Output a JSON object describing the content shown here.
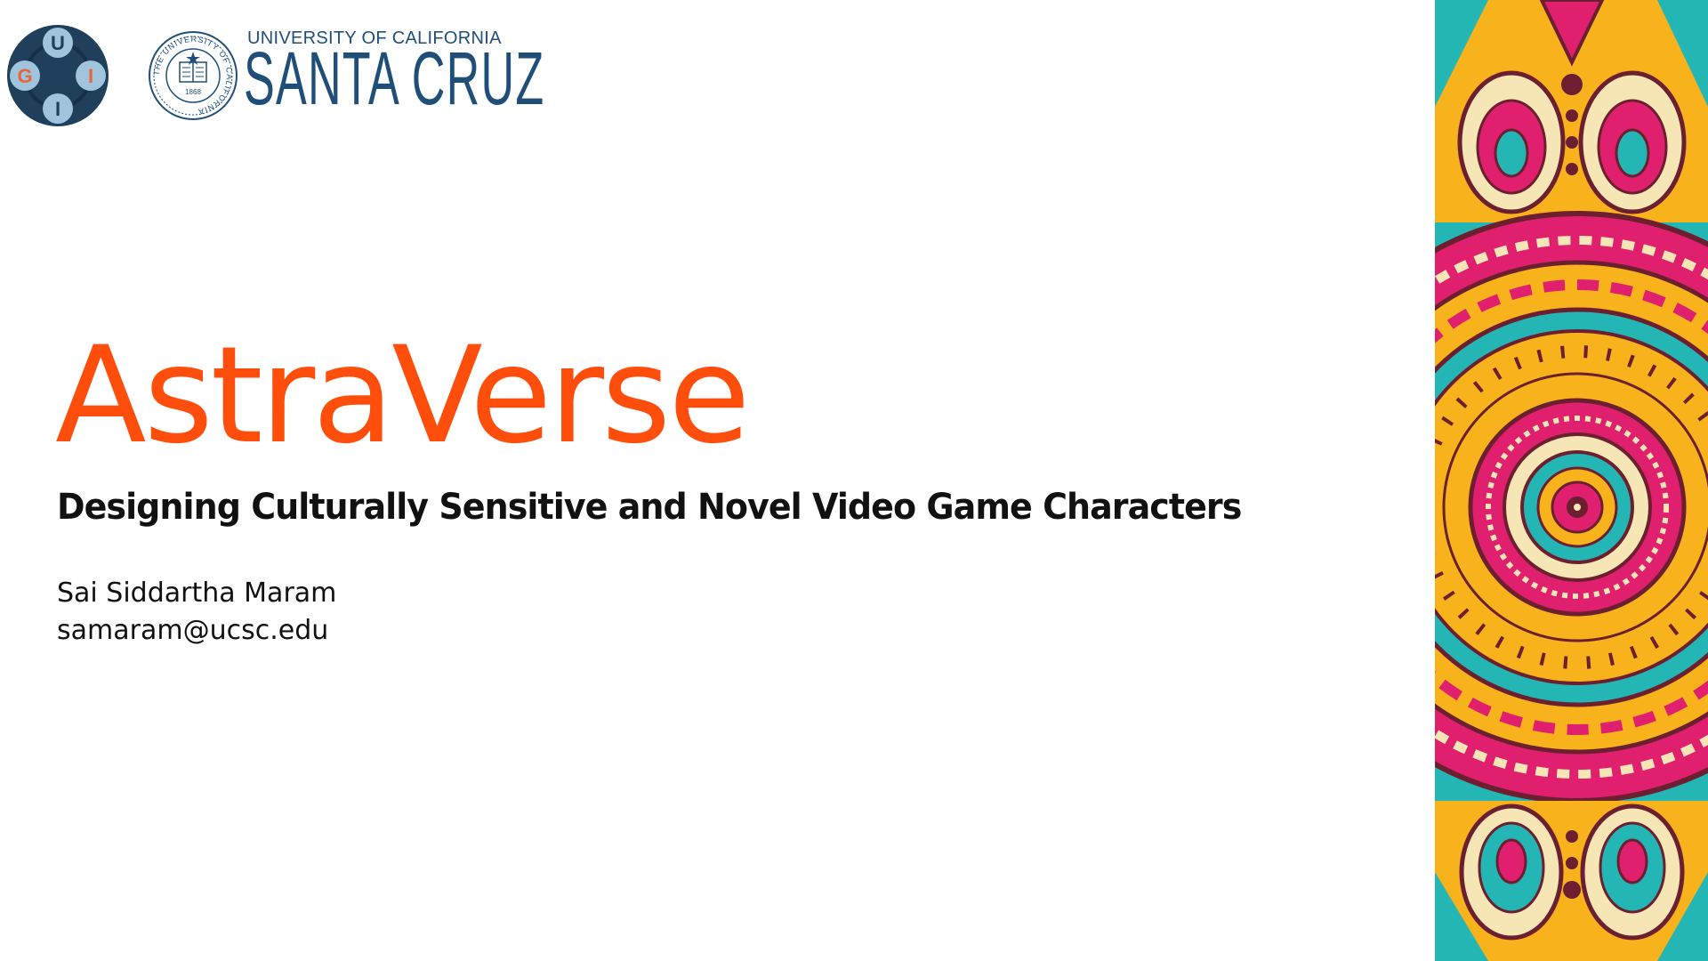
{
  "slide": {
    "title": "AstraVerse",
    "subtitle": "Designing Culturally Sensitive and Novel Video Game Characters",
    "author": "Sai Siddartha Maram",
    "email": "samaram@ucsc.edu"
  },
  "logos": {
    "gii": {
      "letters": [
        "U",
        "G",
        "I",
        "I"
      ]
    },
    "ucsc": {
      "line1": "UNIVERSITY OF CALIFORNIA",
      "line2": "SANTA CRUZ",
      "seal_text": "THE UNIVERSITY OF CALIFORNIA",
      "seal_year": "1868"
    }
  },
  "colors": {
    "title": "#ff4e0c",
    "text": "#111111",
    "ucsc_blue": "#1f4e79",
    "gii_dark": "#1f3f5b",
    "gii_light": "#9fc4dc",
    "gii_orange": "#e8643a",
    "mandala_pink": "#e0206e",
    "mandala_teal": "#24b6b4",
    "mandala_yellow": "#f7b21c",
    "mandala_maroon": "#6b1f2f",
    "mandala_cream": "#f7e6b5"
  }
}
